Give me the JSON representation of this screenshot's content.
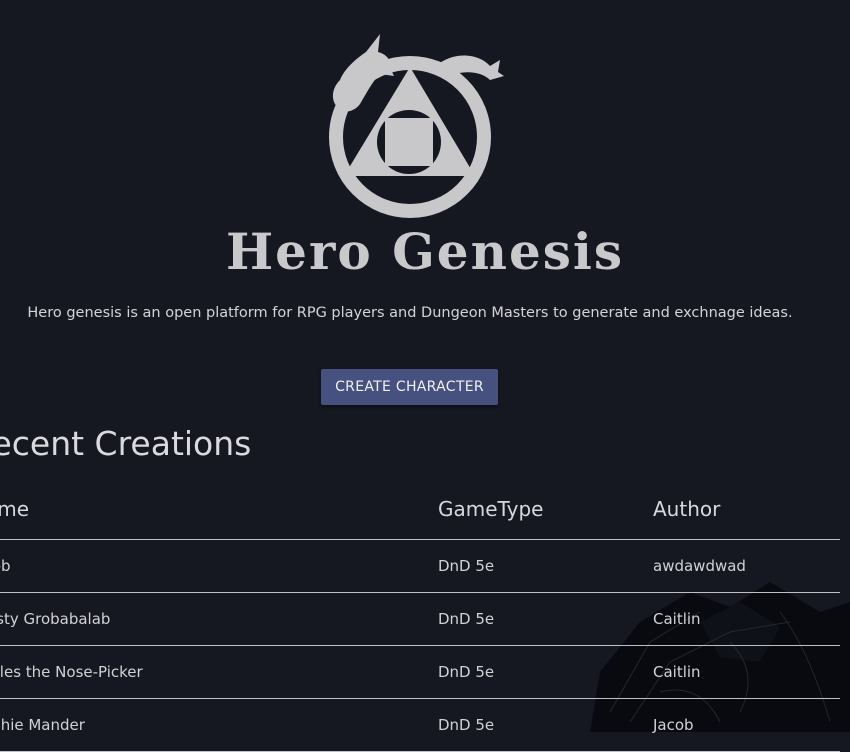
{
  "brand": {
    "name": "Hero Genesis"
  },
  "hero": {
    "tagline": "Hero genesis is an open platform for RPG players and Dungeon Masters to generate and exchnage ideas.",
    "cta_label": "CREATE CHARACTER"
  },
  "recent": {
    "title": "Recent Creations",
    "columns": [
      "Name",
      "GameType",
      "Author"
    ],
    "rows": [
      {
        "name": "Jacob",
        "game_type": "DnD 5e",
        "author": "awdawdwad"
      },
      {
        "name": "Crusty Grobabalab",
        "game_type": "DnD 5e",
        "author": "Caitlin"
      },
      {
        "name": "Tickles the Nose-Picker",
        "game_type": "DnD 5e",
        "author": "Caitlin"
      },
      {
        "name": "Muchie Mander",
        "game_type": "DnD 5e",
        "author": "Jacob"
      }
    ]
  },
  "colors": {
    "background": "#161821",
    "accent": "#47517f",
    "logo": "#c8c8ca"
  },
  "icons": {
    "logo": "dragon-circle-triangle-square-icon",
    "background": "warrior-sketch-illustration"
  }
}
